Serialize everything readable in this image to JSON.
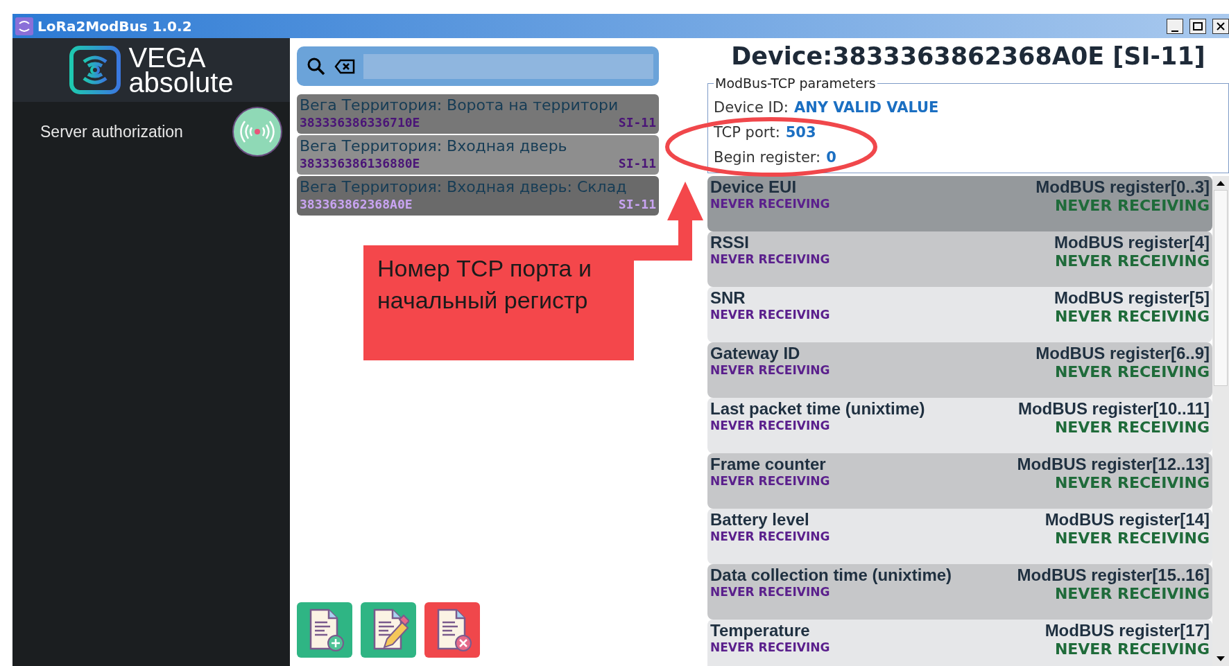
{
  "window": {
    "title": "LoRa2ModBus 1.0.2"
  },
  "sidebar": {
    "logo": {
      "top": "VEGA",
      "bottom": "absolute"
    },
    "items": [
      {
        "label": "Server authorization"
      }
    ]
  },
  "devices": [
    {
      "name": "Вега Территория: Ворота на территори",
      "eui": "383336386336710E",
      "type": "SI-11",
      "selected": false
    },
    {
      "name": "Вега Территория: Входная дверь",
      "eui": "383336386136880E",
      "type": "SI-11",
      "selected": false
    },
    {
      "name": "Вега Территория: Входная дверь: Склад",
      "eui": "383363862368A0E",
      "type": "SI-11",
      "selected": true
    }
  ],
  "device_panel": {
    "title": "Device:3833363862368A0E [SI-11]",
    "params_legend": "ModBus-TCP parameters",
    "params": [
      {
        "label": "Device ID:",
        "value": "ANY VALID VALUE"
      },
      {
        "label": "TCP port:",
        "value": "503"
      },
      {
        "label": "Begin register:",
        "value": "0"
      }
    ],
    "registers": [
      {
        "name": "Device EUI",
        "status": "NEVER RECEIVING",
        "register": "ModBUS register[0..3]",
        "value": "NEVER RECEIVING",
        "selected": true
      },
      {
        "name": "RSSI",
        "status": "NEVER RECEIVING",
        "register": "ModBUS register[4]",
        "value": "NEVER RECEIVING",
        "selected": false
      },
      {
        "name": "SNR",
        "status": "NEVER RECEIVING",
        "register": "ModBUS register[5]",
        "value": "NEVER RECEIVING",
        "selected": false
      },
      {
        "name": "Gateway ID",
        "status": "NEVER RECEIVING",
        "register": "ModBUS register[6..9]",
        "value": "NEVER RECEIVING",
        "selected": false
      },
      {
        "name": "Last packet time (unixtime)",
        "status": "NEVER RECEIVING",
        "register": "ModBUS register[10..11]",
        "value": "NEVER RECEIVING",
        "selected": false
      },
      {
        "name": "Frame counter",
        "status": "NEVER RECEIVING",
        "register": "ModBUS register[12..13]",
        "value": "NEVER RECEIVING",
        "selected": false
      },
      {
        "name": "Battery level",
        "status": "NEVER RECEIVING",
        "register": "ModBUS register[14]",
        "value": "NEVER RECEIVING",
        "selected": false
      },
      {
        "name": "Data collection time (unixtime)",
        "status": "NEVER RECEIVING",
        "register": "ModBUS register[15..16]",
        "value": "NEVER RECEIVING",
        "selected": false
      },
      {
        "name": "Temperature",
        "status": "NEVER RECEIVING",
        "register": "ModBUS register[17]",
        "value": "NEVER RECEIVING",
        "selected": false
      }
    ]
  },
  "annotation": {
    "text": "Номер TCP порта и начальный регистр"
  }
}
